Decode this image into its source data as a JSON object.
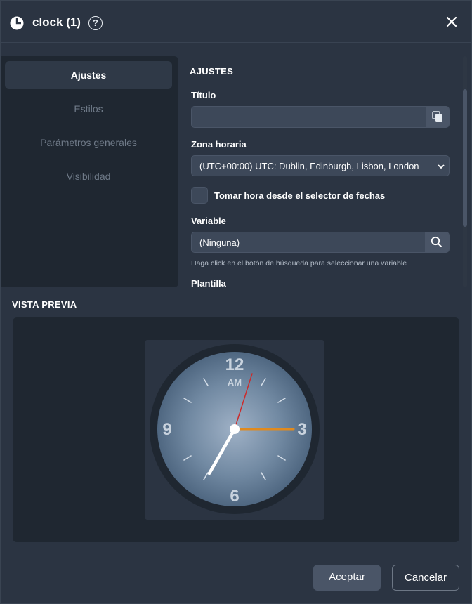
{
  "dialog": {
    "title": "clock (1)",
    "help_glyph": "?"
  },
  "nav": {
    "items": [
      {
        "label": "Ajustes",
        "active": true
      },
      {
        "label": "Estilos",
        "active": false
      },
      {
        "label": "Parámetros generales",
        "active": false
      },
      {
        "label": "Visibilidad",
        "active": false
      }
    ]
  },
  "settings": {
    "heading": "AJUSTES",
    "title_label": "Título",
    "title_value": "",
    "timezone_label": "Zona horaria",
    "timezone_value": "(UTC+00:00) UTC: Dublin, Edinburgh, Lisbon, London",
    "date_selector_label": "Tomar hora desde el selector de fechas",
    "date_selector_checked": false,
    "variable_label": "Variable",
    "variable_value": "(Ninguna)",
    "variable_hint": "Haga click en el botón de búsqueda para seleccionar una variable",
    "template_label": "Plantilla"
  },
  "preview": {
    "heading": "VISTA PREVIA",
    "clock": {
      "num_12": "12",
      "num_3": "3",
      "num_6": "6",
      "num_9": "9",
      "ampm": "AM"
    }
  },
  "footer": {
    "accept_label": "Aceptar",
    "cancel_label": "Cancelar"
  },
  "colors": {
    "second_hand": "#cc2b2b",
    "minute_hand": "#e08a1e",
    "hour_hand": "#ffffff",
    "accent_bg": "#2b3442"
  }
}
